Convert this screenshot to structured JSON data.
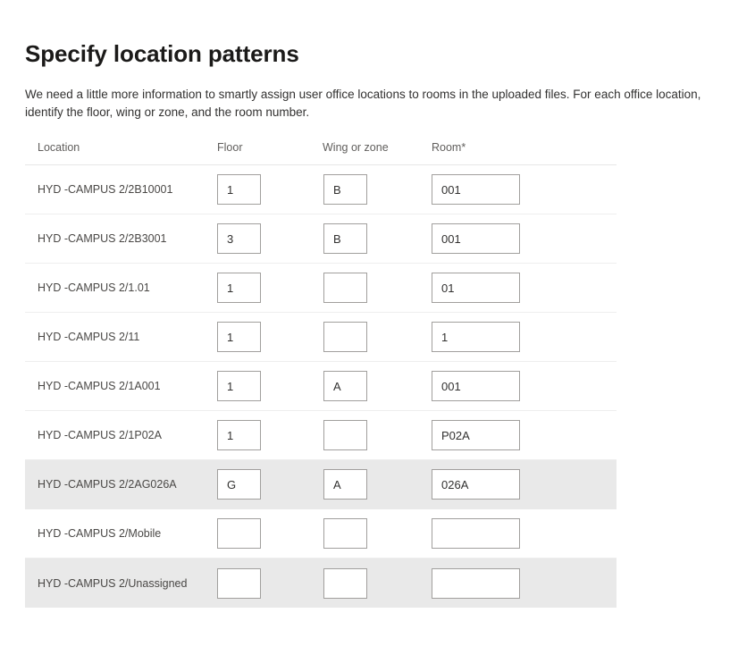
{
  "page": {
    "title": "Specify location patterns",
    "description": "We need a little more information to smartly assign user office locations to rooms in the uploaded files. For each office location, identify the floor, wing or zone, and the room number."
  },
  "table": {
    "columns": {
      "location": "Location",
      "floor": "Floor",
      "wing": "Wing or zone",
      "room": "Room*"
    },
    "rows": [
      {
        "location": "HYD -CAMPUS 2/2B10001",
        "floor": "1",
        "wing": "B",
        "room": "001",
        "shaded": false
      },
      {
        "location": "HYD -CAMPUS 2/2B3001",
        "floor": "3",
        "wing": "B",
        "room": "001",
        "shaded": false
      },
      {
        "location": "HYD -CAMPUS 2/1.01",
        "floor": "1",
        "wing": "",
        "room": "01",
        "shaded": false
      },
      {
        "location": "HYD -CAMPUS 2/11",
        "floor": "1",
        "wing": "",
        "room": "1",
        "shaded": false
      },
      {
        "location": "HYD -CAMPUS 2/1A001",
        "floor": "1",
        "wing": "A",
        "room": "001",
        "shaded": false
      },
      {
        "location": "HYD -CAMPUS 2/1P02A",
        "floor": "1",
        "wing": "",
        "room": "P02A",
        "shaded": false
      },
      {
        "location": "HYD -CAMPUS 2/2AG026A",
        "floor": "G",
        "wing": "A",
        "room": "026A",
        "shaded": true
      },
      {
        "location": "HYD -CAMPUS 2/Mobile",
        "floor": "",
        "wing": "",
        "room": "",
        "shaded": false
      },
      {
        "location": "HYD -CAMPUS 2/Unassigned",
        "floor": "",
        "wing": "",
        "room": "",
        "shaded": true
      }
    ]
  },
  "colors": {
    "shaded_row": "#e9e9e9",
    "field_border": "#a19f9d",
    "divider": "#eeeeee",
    "header_text": "#605e5c"
  }
}
